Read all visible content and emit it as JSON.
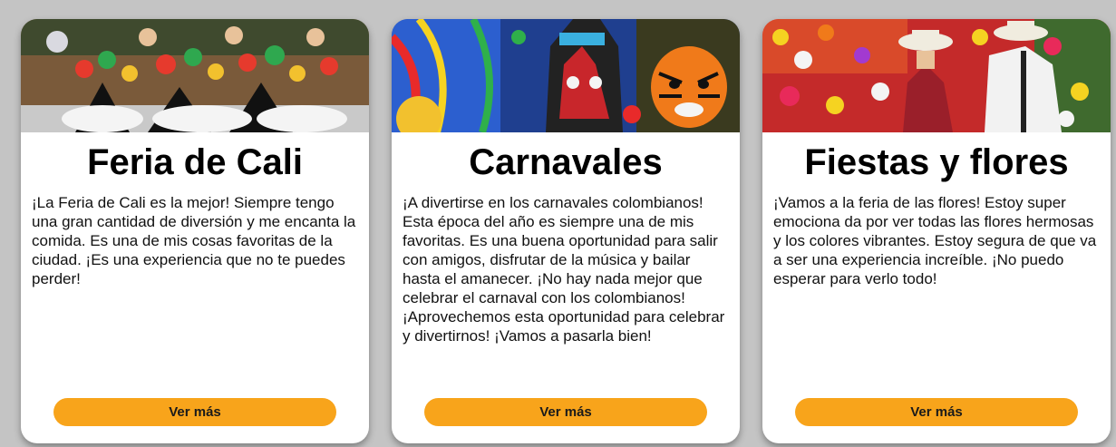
{
  "cards": [
    {
      "title": "Feria de Cali",
      "description": "¡La Feria de Cali es la mejor! Siempre tengo una gran cantidad de diversión y me encanta la comida. Es una de mis cosas favoritas de la ciudad. ¡Es una experiencia que no te puedes perder!",
      "button_label": "Ver más",
      "image_subject": "salsa-dancers-photo"
    },
    {
      "title": "Carnavales",
      "description": "¡A divertirse en los carnavales colombianos! Esta época del año es siempre una de mis favoritas. Es una buena oportunidad para salir con amigos, disfrutar de la música y bailar hasta el amanecer. ¡No hay nada mejor que celebrar el carnaval con los colombianos! ¡Aprovechemos esta oportunidad para celebrar y divertirnos! ¡Vamos a pasarla bien!",
      "button_label": "Ver más",
      "image_subject": "carnival-masks-photo"
    },
    {
      "title": "Fiestas y flores",
      "description": "¡Vamos a la feria de las flores! Estoy super emociona da por ver todas las flores hermosas y los colores vibrantes. Estoy segura de que va a ser una experiencia increíble. ¡No puedo esperar para verlo todo!",
      "button_label": "Ver más",
      "image_subject": "flower-festival-photo"
    }
  ],
  "colors": {
    "background": "#c4c4c4",
    "card": "#ffffff",
    "button": "#f8a41b"
  }
}
